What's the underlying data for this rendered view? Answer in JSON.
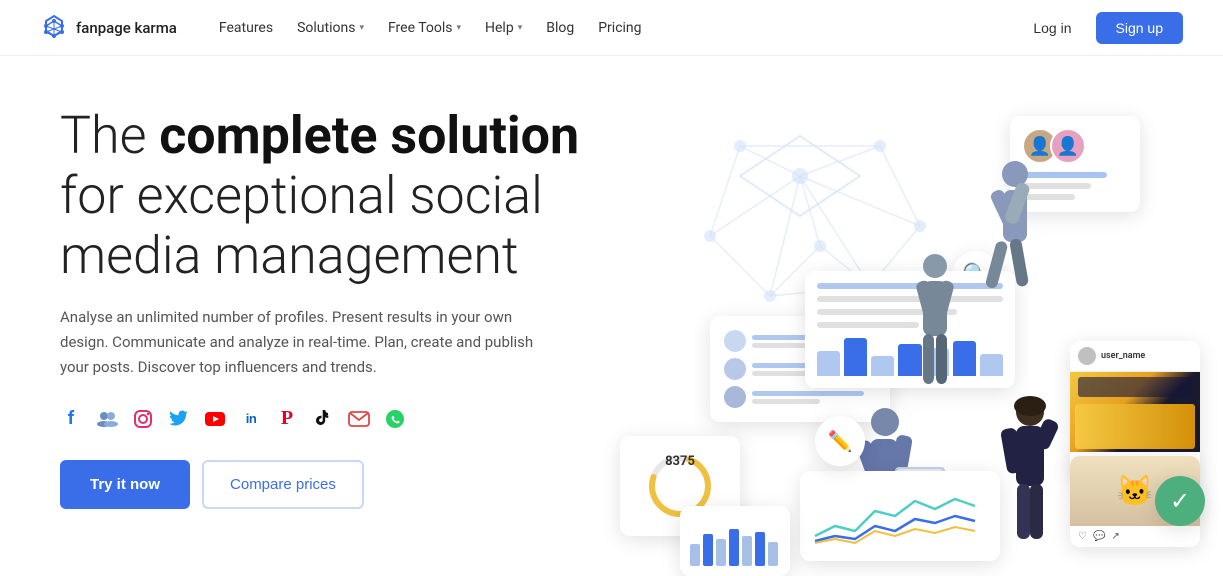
{
  "nav": {
    "logo_text": "fanpage karma",
    "links": [
      {
        "label": "Features",
        "has_dropdown": false
      },
      {
        "label": "Solutions",
        "has_dropdown": true
      },
      {
        "label": "Free Tools",
        "has_dropdown": true
      },
      {
        "label": "Help",
        "has_dropdown": true
      },
      {
        "label": "Blog",
        "has_dropdown": false
      },
      {
        "label": "Pricing",
        "has_dropdown": false
      }
    ],
    "login_label": "Log in",
    "signup_label": "Sign up"
  },
  "hero": {
    "title_prefix": "The ",
    "title_bold": "complete solution",
    "title_suffix": " for exceptional social media management",
    "description": "Analyse an unlimited number of profiles. Present results in your own design. Communicate and analyze in real-time. Plan, create and publish your posts. Discover top influencers and trends.",
    "btn_try": "Try it now",
    "btn_compare": "Compare prices",
    "metric_value": "8375"
  },
  "social_icons": [
    {
      "name": "facebook-icon",
      "symbol": "f",
      "class": "si-fb"
    },
    {
      "name": "users-icon",
      "symbol": "👥",
      "class": "si-users"
    },
    {
      "name": "instagram-icon",
      "symbol": "◎",
      "class": "si-ig"
    },
    {
      "name": "twitter-icon",
      "symbol": "🐦",
      "class": "si-tw"
    },
    {
      "name": "youtube-icon",
      "symbol": "▶",
      "class": "si-yt"
    },
    {
      "name": "linkedin-icon",
      "symbol": "in",
      "class": "si-li"
    },
    {
      "name": "pinterest-icon",
      "symbol": "P",
      "class": "si-pi"
    },
    {
      "name": "tiktok-icon",
      "symbol": "♪",
      "class": "si-tk"
    },
    {
      "name": "email-icon",
      "symbol": "✉",
      "class": "si-em"
    },
    {
      "name": "whatsapp-icon",
      "symbol": "💬",
      "class": "si-wa"
    }
  ],
  "colors": {
    "brand_blue": "#3a6ee8",
    "nav_bg": "#ffffff",
    "hero_bg": "#f8faff"
  }
}
